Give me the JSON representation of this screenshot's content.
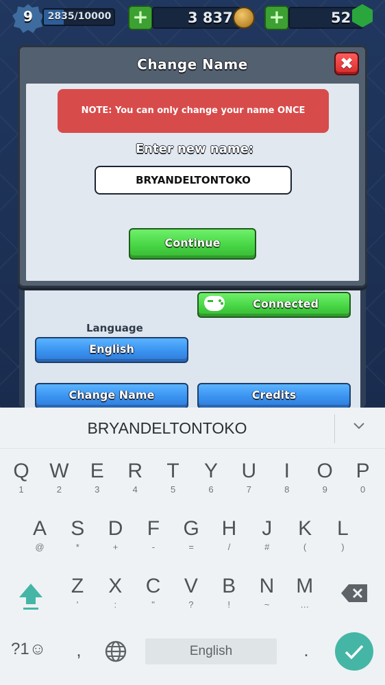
{
  "topbar": {
    "level": "9",
    "xp": "2835/10000",
    "xp_progress": 0.2835,
    "gold": "3 837",
    "gems": "52",
    "plus_symbol": "+"
  },
  "modal": {
    "title": "Change Name",
    "close_symbol": "✖",
    "note": "NOTE: You can only change your name ONCE",
    "enter_label": "Enter new name:",
    "input_value": "BRYANDELTONTOKO",
    "continue_label": "Continue"
  },
  "settings": {
    "connected_label": "Connected",
    "language_label": "Language",
    "language_value": "English",
    "change_name_label": "Change Name",
    "credits_label": "Credits"
  },
  "keyboard": {
    "suggestion": "BRYANDELTONTOKO",
    "row1": [
      {
        "key": "Q",
        "sub": "1"
      },
      {
        "key": "W",
        "sub": "2"
      },
      {
        "key": "E",
        "sub": "3"
      },
      {
        "key": "R",
        "sub": "4"
      },
      {
        "key": "T",
        "sub": "5"
      },
      {
        "key": "Y",
        "sub": "6"
      },
      {
        "key": "U",
        "sub": "7"
      },
      {
        "key": "I",
        "sub": "8"
      },
      {
        "key": "O",
        "sub": "9"
      },
      {
        "key": "P",
        "sub": "0"
      }
    ],
    "row2": [
      {
        "key": "A",
        "sub": "@"
      },
      {
        "key": "S",
        "sub": "*"
      },
      {
        "key": "D",
        "sub": "+"
      },
      {
        "key": "F",
        "sub": "-"
      },
      {
        "key": "G",
        "sub": "="
      },
      {
        "key": "H",
        "sub": "/"
      },
      {
        "key": "J",
        "sub": "#"
      },
      {
        "key": "K",
        "sub": "("
      },
      {
        "key": "L",
        "sub": ")"
      }
    ],
    "row3": [
      {
        "key": "Z",
        "sub": "'"
      },
      {
        "key": "X",
        "sub": ":"
      },
      {
        "key": "C",
        "sub": "\""
      },
      {
        "key": "V",
        "sub": "?"
      },
      {
        "key": "B",
        "sub": "!"
      },
      {
        "key": "N",
        "sub": "~"
      },
      {
        "key": "M",
        "sub": "…"
      }
    ],
    "symbols_label": "?1☺",
    "comma": ",",
    "space_label": "English",
    "period": "."
  },
  "colors": {
    "accent_green": "#48d645",
    "accent_blue": "#3a92f0",
    "note_red": "#d84b4b",
    "keyboard_teal": "#45b6a6"
  }
}
